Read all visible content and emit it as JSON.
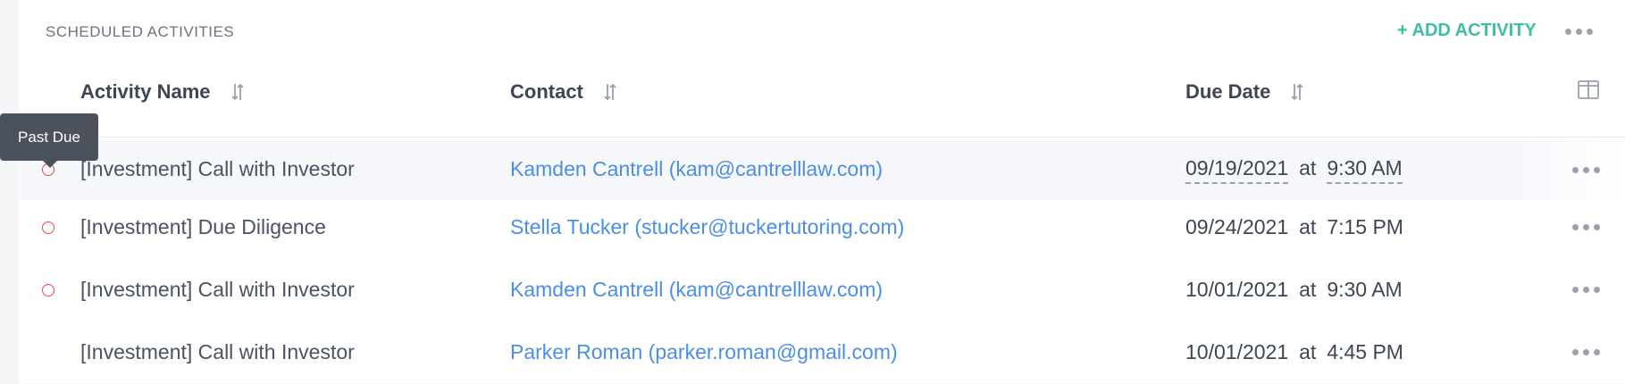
{
  "section": {
    "title": "SCHEDULED ACTIVITIES",
    "add_label": "+ ADD ACTIVITY",
    "more_icon": "more-horizontal-icon"
  },
  "columns": {
    "activity_name": "Activity Name",
    "contact": "Contact",
    "due_date": "Due Date",
    "sort_icon": "sort-arrows-icon",
    "column_toggle_icon": "columns-icon"
  },
  "tooltip": {
    "text": "Past Due"
  },
  "rows": [
    {
      "name": "[Investment] Call with Investor",
      "contact": "Kamden Cantrell (kam@cantrelllaw.com)",
      "date": "09/19/2021",
      "at": "at",
      "time": "9:30 AM",
      "past_due": true
    },
    {
      "name": "[Investment] Due Diligence",
      "contact": "Stella Tucker (stucker@tuckertutoring.com)",
      "date": "09/24/2021",
      "at": "at",
      "time": "7:15 PM",
      "past_due": true
    },
    {
      "name": "[Investment] Call with Investor",
      "contact": "Kamden Cantrell (kam@cantrelllaw.com)",
      "date": "10/01/2021",
      "at": "at",
      "time": "9:30 AM",
      "past_due": true
    },
    {
      "name": "[Investment] Call with Investor",
      "contact": "Parker Roman (parker.roman@gmail.com)",
      "date": "10/01/2021",
      "at": "at",
      "time": "4:45 PM",
      "past_due": false
    }
  ],
  "colors": {
    "accent": "#3ebfa1",
    "link": "#4a8ee8",
    "past_due": "#e5484d"
  }
}
